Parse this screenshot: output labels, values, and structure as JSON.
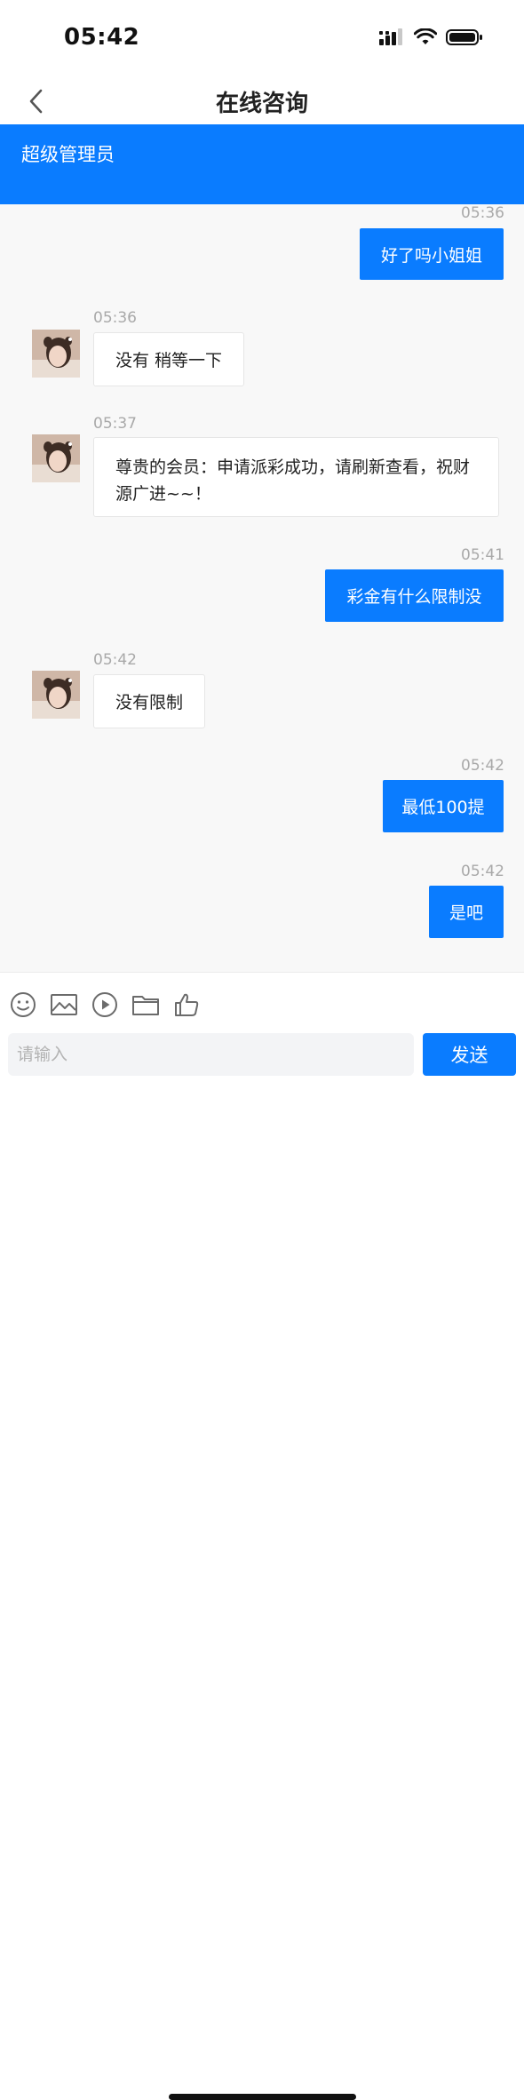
{
  "status_bar": {
    "time": "05:42"
  },
  "header": {
    "title": "在线咨询"
  },
  "agent": {
    "name": "超级管理员"
  },
  "messages": [
    {
      "direction": "out",
      "time": "05:36",
      "text": "好了吗小姐姐"
    },
    {
      "direction": "in",
      "time": "05:36",
      "text": "没有 稍等一下"
    },
    {
      "direction": "in",
      "time": "05:37",
      "text_line1": "尊贵的会员：申请派彩成功，请刷新查看，祝财",
      "text_line2": "源广进~~！"
    },
    {
      "direction": "out",
      "time": "05:41",
      "text": "彩金有什么限制没"
    },
    {
      "direction": "in",
      "time": "05:42",
      "text": "没有限制"
    },
    {
      "direction": "out",
      "time": "05:42",
      "text": "最低100提"
    },
    {
      "direction": "out",
      "time": "05:42",
      "text": "是吧"
    }
  ],
  "toolbar": {
    "icons": [
      "smiley-icon",
      "image-icon",
      "video-play-icon",
      "folder-icon",
      "thumbs-up-icon"
    ]
  },
  "composer": {
    "placeholder": "请输入",
    "value": "",
    "send_label": "发送"
  },
  "colors": {
    "accent": "#0a7cff",
    "chat_background": "#f8f8f8",
    "timestamp": "#a9a9a9"
  }
}
